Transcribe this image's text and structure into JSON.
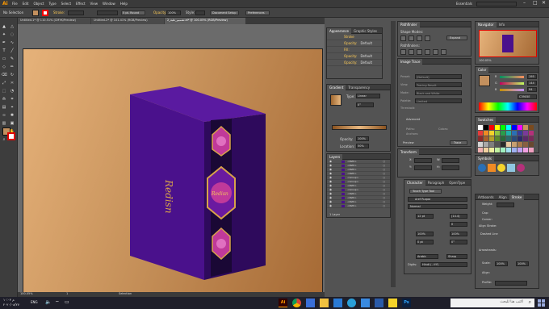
{
  "menubar": {
    "logo": "Ai",
    "items": [
      "File",
      "Edit",
      "Object",
      "Type",
      "Select",
      "Effect",
      "View",
      "Window",
      "Help"
    ],
    "workspace": "Essentials"
  },
  "control": {
    "selection": "No Selection",
    "stroke_label": "Stroke:",
    "brush": "5 pt. Round",
    "opacity_label": "Opacity:",
    "opacity": "100%",
    "style_label": "Style:",
    "doc_setup": "Document Setup",
    "preferences": "Preferences"
  },
  "tabs": [
    "Untitled-1* @ 110.51% (CMYK/Preview)",
    "Untitled-2* @ 101.41% (RGB/Preview)",
    "تصميم_علبة_2.ai* @ 100.05% (RGB/Preview)"
  ],
  "artwork": {
    "brand": "Redisn",
    "colors": {
      "purple": "#4a118c",
      "purple_dark": "#2e0a5c",
      "gold": "#d8a24a",
      "magenta": "#c0399a",
      "background": "#c8935c"
    }
  },
  "appearance": {
    "tabs": [
      "Appearance",
      "Graphic Styles"
    ],
    "rows": [
      {
        "label": "Stroke",
        "value": ""
      },
      {
        "label": "Opacity:",
        "value": "Default"
      },
      {
        "label": "Fill:",
        "value": ""
      },
      {
        "label": "Opacity:",
        "value": "Default"
      },
      {
        "label": "Opacity:",
        "value": "Default"
      }
    ]
  },
  "gradient": {
    "tabs": [
      "Gradient",
      "Transparency"
    ],
    "type_label": "Type:",
    "type_value": "Linear",
    "angle": "0°",
    "opacity_label": "Opacity:",
    "opacity": "100%",
    "location_label": "Location:",
    "location": "50%"
  },
  "layers": {
    "tabs": [
      "Layers"
    ],
    "footer": "1 Layer",
    "rows": [
      "<Path>",
      "<Path>",
      "<Path>",
      "<Path>",
      "<Group>",
      "<Group>",
      "<Path>",
      "<Group>",
      "<Path>",
      "<Path>",
      "<Path>",
      "<Path>"
    ]
  },
  "pathfinder": {
    "tabs": [
      "Pathfinder"
    ],
    "shape_modes": "Shape Modes:",
    "expand": "Expand",
    "pathfinders": "Pathfinders:"
  },
  "image_trace": {
    "tabs": [
      "Image Trace"
    ],
    "rows": [
      {
        "label": "Preset:",
        "value": "[Default]"
      },
      {
        "label": "View:",
        "value": "Tracing Result"
      },
      {
        "label": "Mode:",
        "value": "Black and White"
      },
      {
        "label": "Palette:",
        "value": "Limited"
      }
    ],
    "threshold": "Threshold:",
    "advanced": "Advanced",
    "paths": "Paths:",
    "anchors": "Anchors:",
    "colors": "Colors:",
    "preview": "Preview",
    "trace": "Trace"
  },
  "transform": {
    "tabs": [
      "Transform"
    ],
    "x": "X:",
    "y": "Y:",
    "w": "W:",
    "h": "H:"
  },
  "character": {
    "tabs": [
      "Character",
      "Paragraph",
      "OpenType"
    ],
    "touch": "Touch Type Tool",
    "font": "Aref Ruqaa",
    "style": "Normal",
    "size": "12 pt",
    "leading": "(14.4)",
    "tracking": "0",
    "scale_h": "100%",
    "scale_v": "100%",
    "baseline": "0 pt",
    "rotation": "0°",
    "language": "Arabic",
    "sharp": "Sharp",
    "digits": "Digits:",
    "digits_value": "Hindi (٠١٢٣)",
    "auto": "Auto"
  },
  "navigator": {
    "tabs": [
      "Navigator",
      "Info"
    ],
    "zoom": "100.05%"
  },
  "color": {
    "tabs": [
      "Color"
    ],
    "r": "R",
    "g": "G",
    "b": "B",
    "r_val": "195",
    "g_val": "144",
    "b_val": "94",
    "hex": "C3905E"
  },
  "swatches": {
    "tabs": [
      "Swatches"
    ]
  },
  "symbols": {
    "tabs": [
      "Symbols"
    ]
  },
  "stroke": {
    "tabs": [
      "Artboards",
      "Align",
      "Stroke"
    ],
    "weight_label": "Weight:",
    "weight": "",
    "cap": "Cap:",
    "corner": "Corner:",
    "align": "Align Stroke:",
    "dashed": "Dashed Line",
    "arrowheads": "Arrowheads:",
    "scale": "Scale:",
    "align2": "Align:",
    "profile": "Profile:",
    "scale_val1": "100%",
    "scale_val2": "100%"
  },
  "status": {
    "zoom": "100.05%",
    "page": "1",
    "tool": "Selection"
  },
  "taskbar": {
    "search_placeholder": "اكتب هنا للبحث",
    "time": "۱۰:۰۴ م",
    "date": "۲۰۲۰/۰۸/۲۷",
    "lang": "ENG"
  },
  "swatch_colors": [
    "#ffffff",
    "#000000",
    "#ff0000",
    "#ffff00",
    "#00ff00",
    "#00ffff",
    "#0000ff",
    "#ff00ff",
    "#c8935c",
    "#7a4a1e",
    "#e83a3a",
    "#f08a24",
    "#f5d32a",
    "#8fc640",
    "#2a9d4a",
    "#1fb2a8",
    "#2a6fb5",
    "#3a3a9a",
    "#7a3a9a",
    "#b5307a",
    "#8c2a2a",
    "#a8602a",
    "#b5a02a",
    "#5a8a2a",
    "#2a6a3a",
    "#2a6a6a",
    "#2a4a7a",
    "#2a2a6a",
    "#5a2a6a",
    "#7a2a5a",
    "#d4d4d4",
    "#a8a8a8",
    "#7e7e7e",
    "#545454",
    "#2a2a2a",
    "#e8c8a0",
    "#c8a070",
    "#a87848",
    "#886040",
    "#684830",
    "#f0b0b0",
    "#f0d0a0",
    "#f0f0a0",
    "#c0f0a0",
    "#a0f0c0",
    "#a0e0f0",
    "#a0b0f0",
    "#c0a0f0",
    "#f0a0e0",
    "#f0a0c0"
  ]
}
